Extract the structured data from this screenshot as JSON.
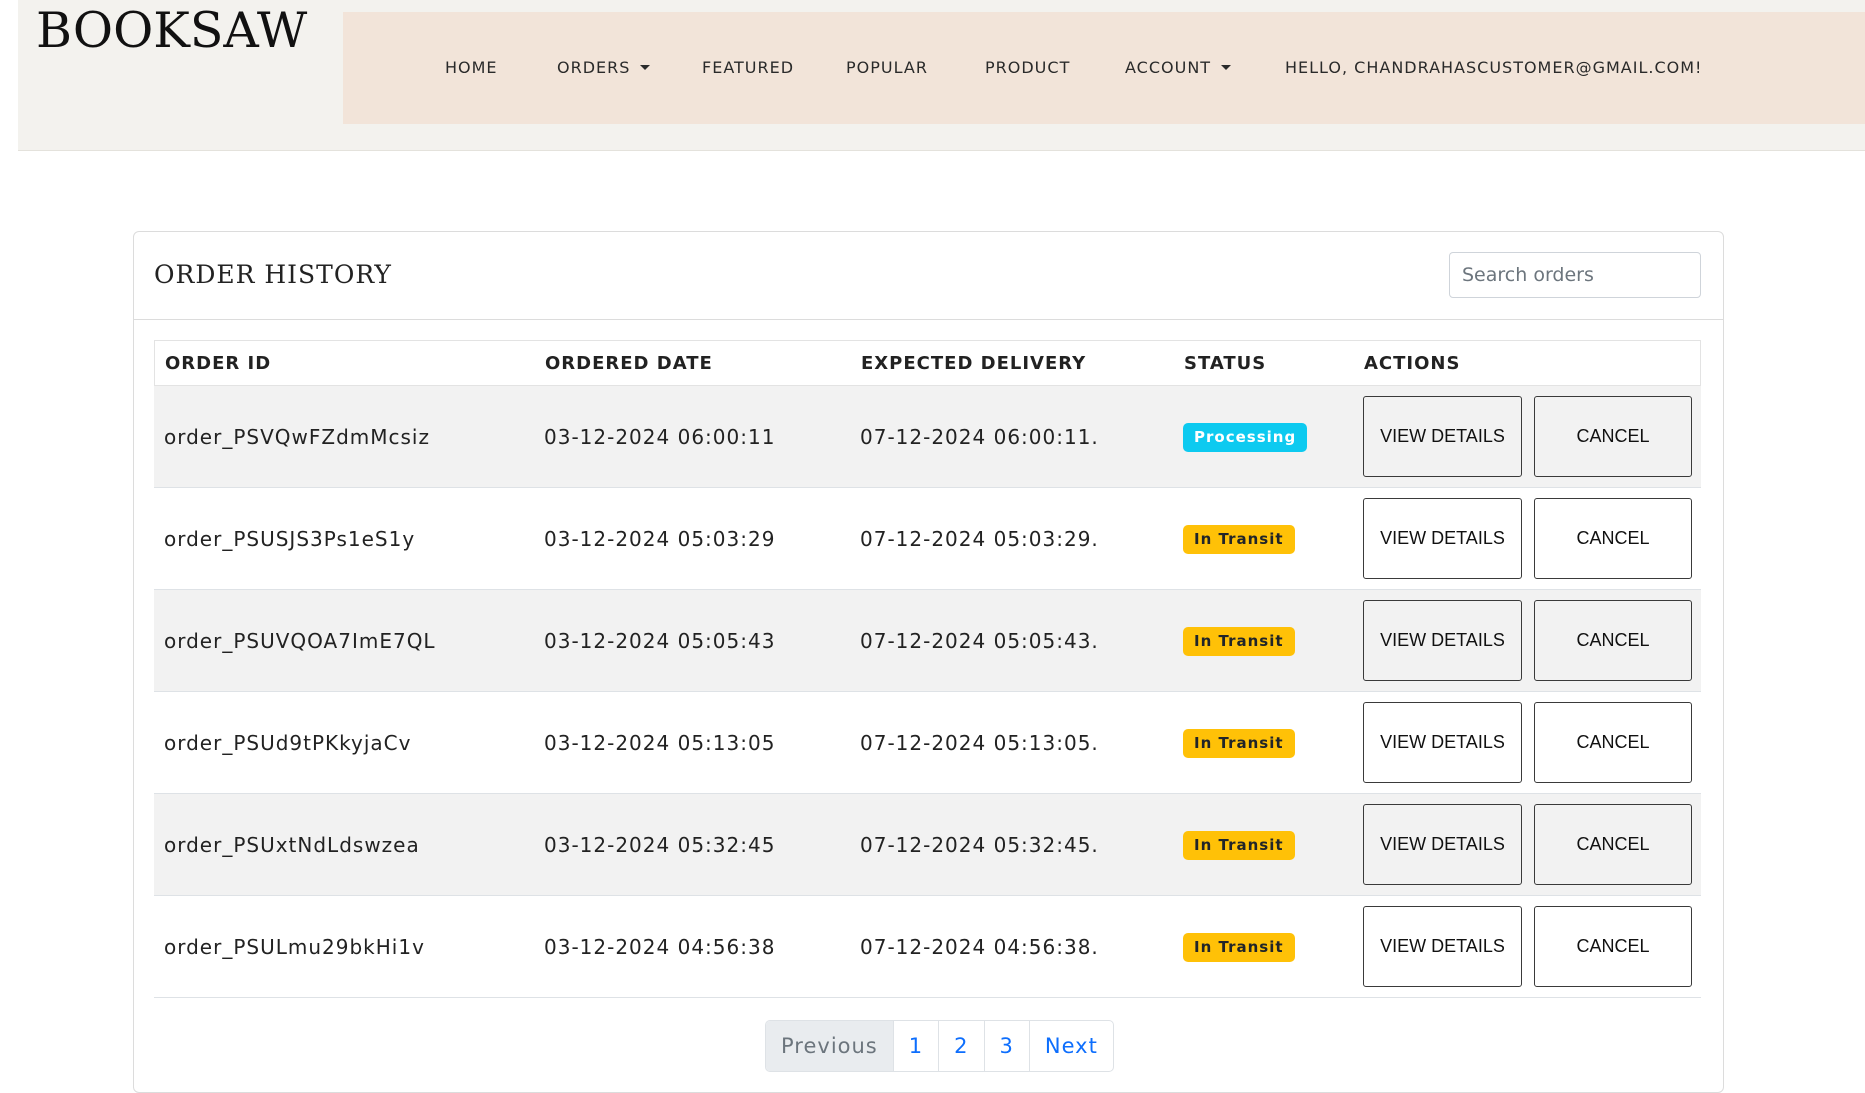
{
  "brand": {
    "logo": "BOOKSAW"
  },
  "nav": {
    "home": "HOME",
    "orders": "ORDERS",
    "featured": "FEATURED",
    "popular": "POPULAR",
    "product": "PRODUCT",
    "account": "ACCOUNT",
    "greeting": "HELLO, CHANDRAHASCUSTOMER@GMAIL.COM!"
  },
  "card": {
    "title": "ORDER HISTORY",
    "search_placeholder": "Search orders"
  },
  "table": {
    "headers": {
      "order_id": "ORDER ID",
      "ordered_date": "ORDERED DATE",
      "expected_delivery": "EXPECTED DELIVERY",
      "status": "STATUS",
      "actions": "ACTIONS"
    },
    "rows": [
      {
        "order_id": "order_PSVQwFZdmMcsiz",
        "ordered": "03-12-2024 06:00:11",
        "expected": "07-12-2024 06:00:11.",
        "status": "Processing",
        "view": "VIEW DETAILS",
        "cancel": "CANCEL"
      },
      {
        "order_id": "order_PSUSJS3Ps1eS1y",
        "ordered": "03-12-2024 05:03:29",
        "expected": "07-12-2024 05:03:29.",
        "status": "In Transit",
        "view": "VIEW DETAILS",
        "cancel": "CANCEL"
      },
      {
        "order_id": "order_PSUVQOA7ImE7QL",
        "ordered": "03-12-2024 05:05:43",
        "expected": "07-12-2024 05:05:43.",
        "status": "In Transit",
        "view": "VIEW DETAILS",
        "cancel": "CANCEL"
      },
      {
        "order_id": "order_PSUd9tPKkyjaCv",
        "ordered": "03-12-2024 05:13:05",
        "expected": "07-12-2024 05:13:05.",
        "status": "In Transit",
        "view": "VIEW DETAILS",
        "cancel": "CANCEL"
      },
      {
        "order_id": "order_PSUxtNdLdswzea",
        "ordered": "03-12-2024 05:32:45",
        "expected": "07-12-2024 05:32:45.",
        "status": "In Transit",
        "view": "VIEW DETAILS",
        "cancel": "CANCEL"
      },
      {
        "order_id": "order_PSULmu29bkHi1v",
        "ordered": "03-12-2024 04:56:38",
        "expected": "07-12-2024 04:56:38.",
        "status": "In Transit",
        "view": "VIEW DETAILS",
        "cancel": "CANCEL"
      }
    ]
  },
  "pagination": {
    "previous": "Previous",
    "pages": [
      "1",
      "2",
      "3"
    ],
    "next": "Next"
  },
  "colors": {
    "navbar_bg": "#f2e4d9",
    "header_bg": "#f3f2ee",
    "badge_processing": "#0dcaf0",
    "badge_transit": "#ffc107",
    "link": "#0d6efd"
  }
}
